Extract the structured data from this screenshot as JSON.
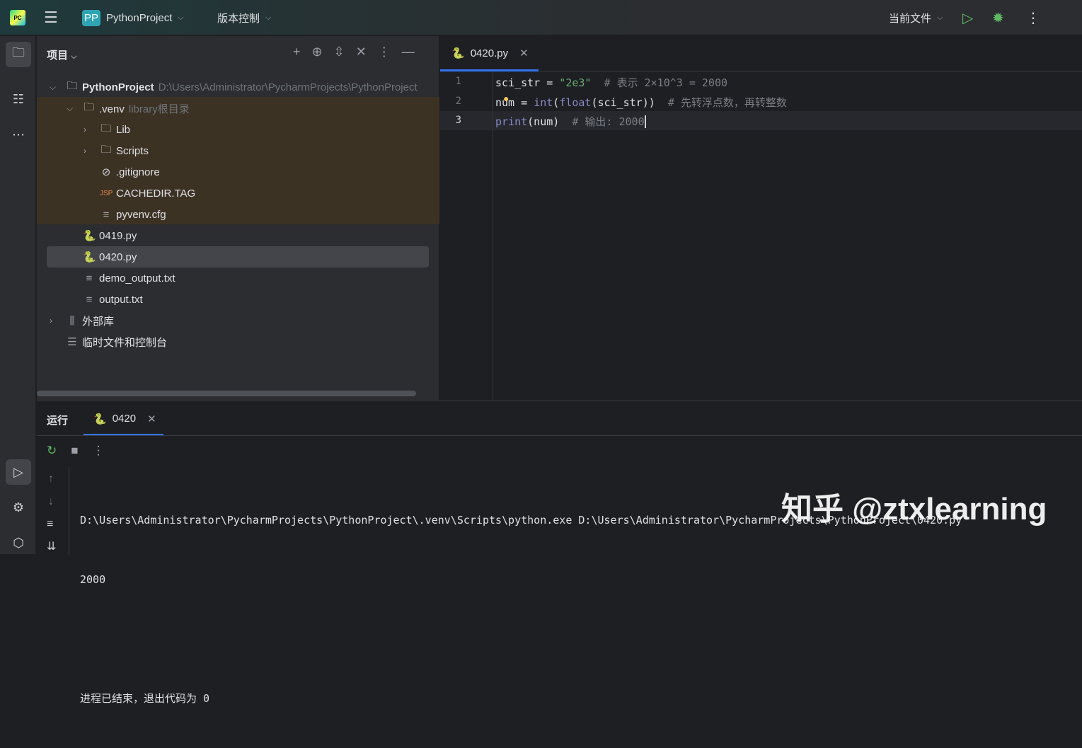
{
  "topbar": {
    "logo": "PC",
    "project_badge": "PP",
    "project_name": "PythonProject",
    "vcs": "版本控制",
    "run_config": "当前文件"
  },
  "project_panel": {
    "title": "项目",
    "tree": [
      {
        "label": "PythonProject",
        "hint": "D:\\Users\\Administrator\\PycharmProjects\\PythonProject"
      },
      {
        "label": ".venv",
        "hint": "library根目录"
      },
      {
        "label": "Lib"
      },
      {
        "label": "Scripts"
      },
      {
        "label": ".gitignore"
      },
      {
        "label": "CACHEDIR.TAG",
        "icon_text": "JSP"
      },
      {
        "label": "pyvenv.cfg"
      },
      {
        "label": "0419.py"
      },
      {
        "label": "0420.py"
      },
      {
        "label": "demo_output.txt"
      },
      {
        "label": "output.txt"
      },
      {
        "label": "外部库"
      },
      {
        "label": "临时文件和控制台"
      }
    ]
  },
  "editor": {
    "tab": "0420.py",
    "line_numbers": [
      "1",
      "2",
      "3"
    ],
    "lines": [
      [
        {
          "t": "sci_str = ",
          "c": ""
        },
        {
          "t": "\"2e3\"",
          "c": "str"
        },
        {
          "t": "  # 表示 2×10^3 = 2000",
          "c": "cm"
        }
      ],
      [
        {
          "t": "num = ",
          "c": ""
        },
        {
          "t": "int",
          "c": "bi"
        },
        {
          "t": "(",
          "c": ""
        },
        {
          "t": "float",
          "c": "bi"
        },
        {
          "t": "(sci_str))",
          "c": ""
        },
        {
          "t": "  # 先转浮点数，再转整数",
          "c": "cm"
        }
      ],
      [
        {
          "t": "print",
          "c": "bi"
        },
        {
          "t": "(num)",
          "c": ""
        },
        {
          "t": "  # 输出: 2000",
          "c": "cm"
        }
      ]
    ]
  },
  "run": {
    "label": "运行",
    "tab": "0420",
    "output": [
      "D:\\Users\\Administrator\\PycharmProjects\\PythonProject\\.venv\\Scripts\\python.exe D:\\Users\\Administrator\\PycharmProjects\\PythonProject\\0420.py",
      "2000",
      "",
      "进程已结束，退出代码为 0"
    ]
  },
  "watermark": "知乎 @ztxlearning"
}
